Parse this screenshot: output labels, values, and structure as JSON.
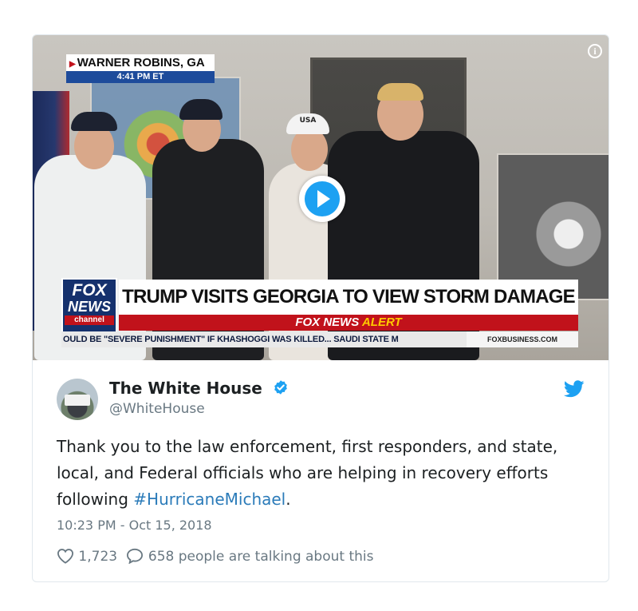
{
  "video": {
    "location_place": "WARNER ROBINS, GA",
    "location_time": "4:41 PM ET",
    "cap_text": "USA",
    "logo_fox": "FOX",
    "logo_news": "NEWS",
    "logo_channel": "channel",
    "headline": "TRUMP VISITS GEORGIA TO VIEW STORM DAMAGE",
    "alert_prefix": "FOX NEWS",
    "alert_word": "ALERT",
    "ticker": "OULD BE \"SEVERE PUNISHMENT\" IF KHASHOGGI WAS KILLED...  SAUDI STATE M",
    "ticker_brand": "FOXBUSINESS.COM",
    "play_icon": "play-icon",
    "info_icon": "info-icon",
    "info_glyph": "i"
  },
  "tweet": {
    "author_name": "The White House",
    "handle": "@WhiteHouse",
    "text_before": "Thank you to the law enforcement, first responders, and state, local, and Federal officials who are helping in recovery efforts following ",
    "hashtag": "#HurricaneMichael",
    "text_after": ".",
    "timestamp": "10:23 PM - Oct 15, 2018",
    "likes": "1,723",
    "talking": "658 people are talking about this"
  },
  "colors": {
    "link": "#2b7bb9",
    "verified": "#1da1f2",
    "twitter_blue": "#1da1f2",
    "muted": "#697882",
    "fox_red": "#c1121b",
    "fox_blue": "#15316d"
  }
}
